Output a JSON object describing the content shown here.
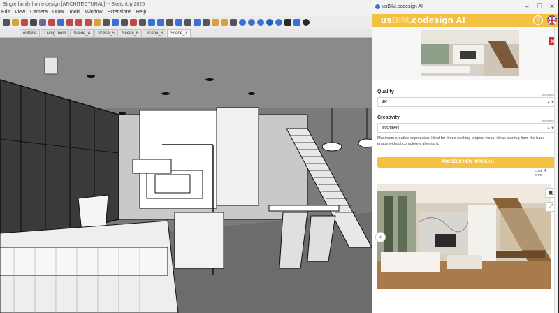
{
  "sketchup": {
    "window_title": "Single family home design [ARCHITECTURAL]* - SketchUp 2025",
    "menu": [
      "Edit",
      "View",
      "Camera",
      "Draw",
      "Tools",
      "Window",
      "Extensions",
      "Help"
    ],
    "scene_tabs": [
      "outside",
      "Living room",
      "Scene_4",
      "Scene_5",
      "Scene_6",
      "Scene_6",
      "Scene_7"
    ],
    "active_tab_index": 6
  },
  "plugin": {
    "window_title": "usBIM.codesign AI",
    "brand_prefix": "us",
    "brand_bim": "BIM",
    "brand_suffix": ".codesign AI",
    "help_label": "?",
    "quality": {
      "label": "Quality",
      "mandatory": "mandatory",
      "value": "4K"
    },
    "creativity": {
      "label": "Creativity",
      "mandatory": "mandatory",
      "value": "Inspired"
    },
    "creativity_description": "Maximum creative expression. Ideal for those seeking original visual ideas starting from the base image without completely altering it.",
    "process_button": "PROCESS NEW IMAGE (1)",
    "cost": "cost: 4 cred",
    "remove_label": "✕"
  },
  "colors": {
    "accent": "#f5c143",
    "viewport_bg": "#7b7b7b",
    "remove": "#d62e2e"
  }
}
